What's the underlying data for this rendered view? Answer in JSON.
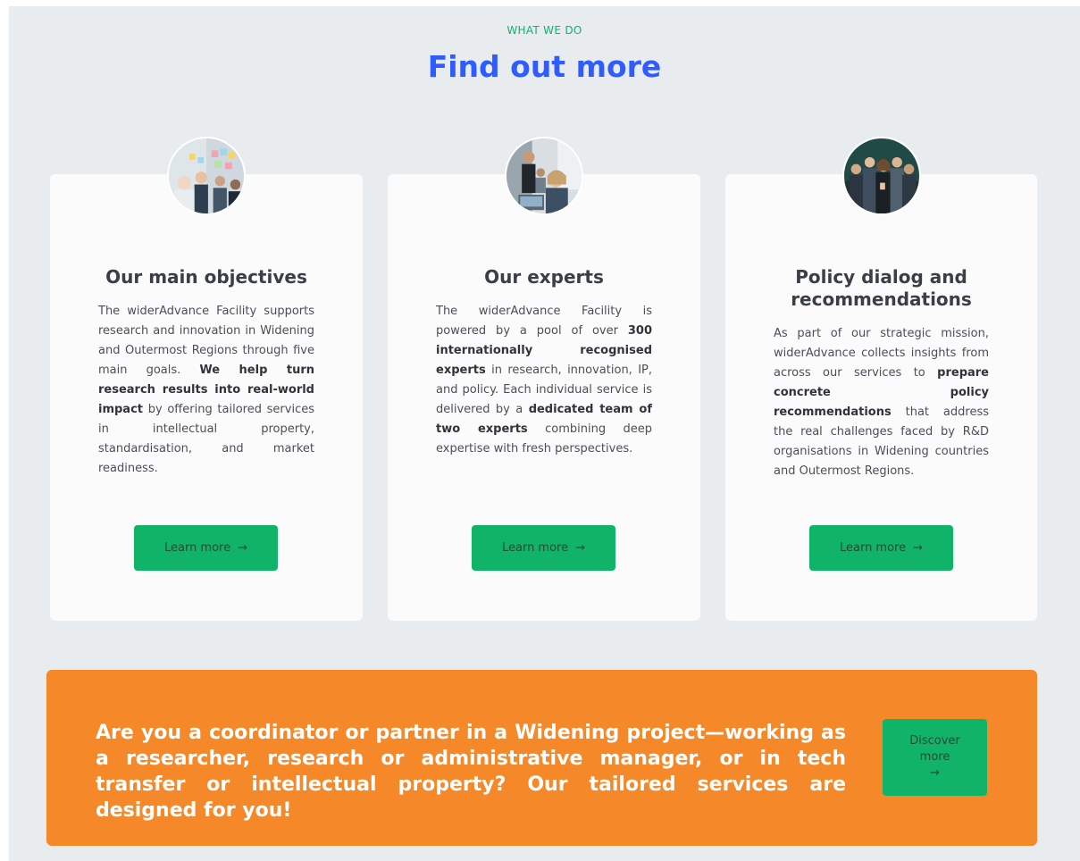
{
  "section": {
    "eyebrow": "WHAT WE DO",
    "heading": "Find out more"
  },
  "cards": [
    {
      "title": "Our main objectives",
      "body_html": "The widerAdvance Facility supports research and innovation in Widening and Outermost Regions through five main goals. <b>We help turn research results into real-world impact</b> by offering tailored services in intellectual property, standardisation, and market readiness.",
      "button": "Learn more",
      "image_icon": "team-brainstorm-photo"
    },
    {
      "title": "Our experts",
      "body_html": "The widerAdvance Facility is powered by a pool of over <b>300 internationally recognised experts</b> in research, innovation, IP, and policy. Each individual service is delivered by a <b>dedicated team of two experts</b> combining deep expertise with fresh perspectives.",
      "button": "Learn more",
      "image_icon": "experts-meeting-photo"
    },
    {
      "title": "Policy dialog and recommendations",
      "body_html": "As part of our strategic mission, widerAdvance collects insights from across our services to <b>prepare concrete policy recommendations</b> that address the real challenges faced by R&amp;D organisations in Widening countries and Outermost Regions.",
      "button": "Learn more",
      "image_icon": "group-thumbs-up-photo"
    }
  ],
  "cta": {
    "text": "Are you a coordinator or partner in a Widening project—working as a researcher, research or administrative manager, or in tech transfer or intellectual property? Our tailored services are designed for you!",
    "button_line1": "Discover",
    "button_line2": "more"
  },
  "icons": {
    "arrow": "→"
  },
  "colors": {
    "accent_green": "#10b368",
    "heading_blue": "#2f5cff",
    "cta_orange": "#f5892a",
    "background": "#e9ecef"
  }
}
